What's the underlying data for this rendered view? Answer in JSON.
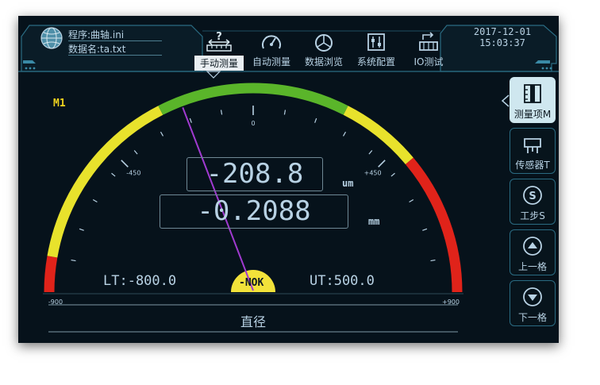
{
  "header": {
    "program_line": "程序:曲轴.ini",
    "data_line": "数据名:ta.txt",
    "date": "2017-12-01",
    "time": "15:03:37"
  },
  "tabs": [
    {
      "label": "手动测量",
      "icon": "manual-measure-icon",
      "active": true
    },
    {
      "label": "自动测量",
      "icon": "gauge-icon",
      "active": false
    },
    {
      "label": "数据浏览",
      "icon": "pie-chart-icon",
      "active": false
    },
    {
      "label": "系统配置",
      "icon": "sliders-icon",
      "active": false
    },
    {
      "label": "IO测试",
      "icon": "io-test-icon",
      "active": false
    }
  ],
  "side_buttons": [
    {
      "label": "测量项M",
      "icon": "ruler-icon",
      "active": true
    },
    {
      "label": "传感器T",
      "icon": "sensor-icon",
      "active": false
    },
    {
      "label": "工步S",
      "icon": "step-s-icon",
      "active": false
    },
    {
      "label": "上一格",
      "icon": "arrow-up-icon",
      "active": false
    },
    {
      "label": "下一格",
      "icon": "arrow-down-icon",
      "active": false
    }
  ],
  "measure": {
    "item_label": "M1",
    "value_um": "-208.8",
    "unit_um": "um",
    "value_mm": "-0.2088",
    "unit_mm": "mm",
    "lower_limit": "LT:-800.0",
    "upper_limit": "UT:500.0",
    "status": "-NOK",
    "feature_name": "直径"
  },
  "gauge": {
    "min": -900,
    "max": 900,
    "needle_value": -208.8,
    "tick_labels": [
      "-900",
      "-450",
      "0",
      "+450",
      "+900"
    ],
    "zones": [
      {
        "from": -900,
        "to": -800,
        "color": "#e0231a"
      },
      {
        "from": -800,
        "to": -270,
        "color": "#e8e22c"
      },
      {
        "from": -270,
        "to": 270,
        "color": "#5ab52a"
      },
      {
        "from": 270,
        "to": 500,
        "color": "#e8e22c"
      },
      {
        "from": 500,
        "to": 900,
        "color": "#e0231a"
      }
    ],
    "needle_color": "#a03ad0",
    "status_color": "#f2e23a"
  }
}
